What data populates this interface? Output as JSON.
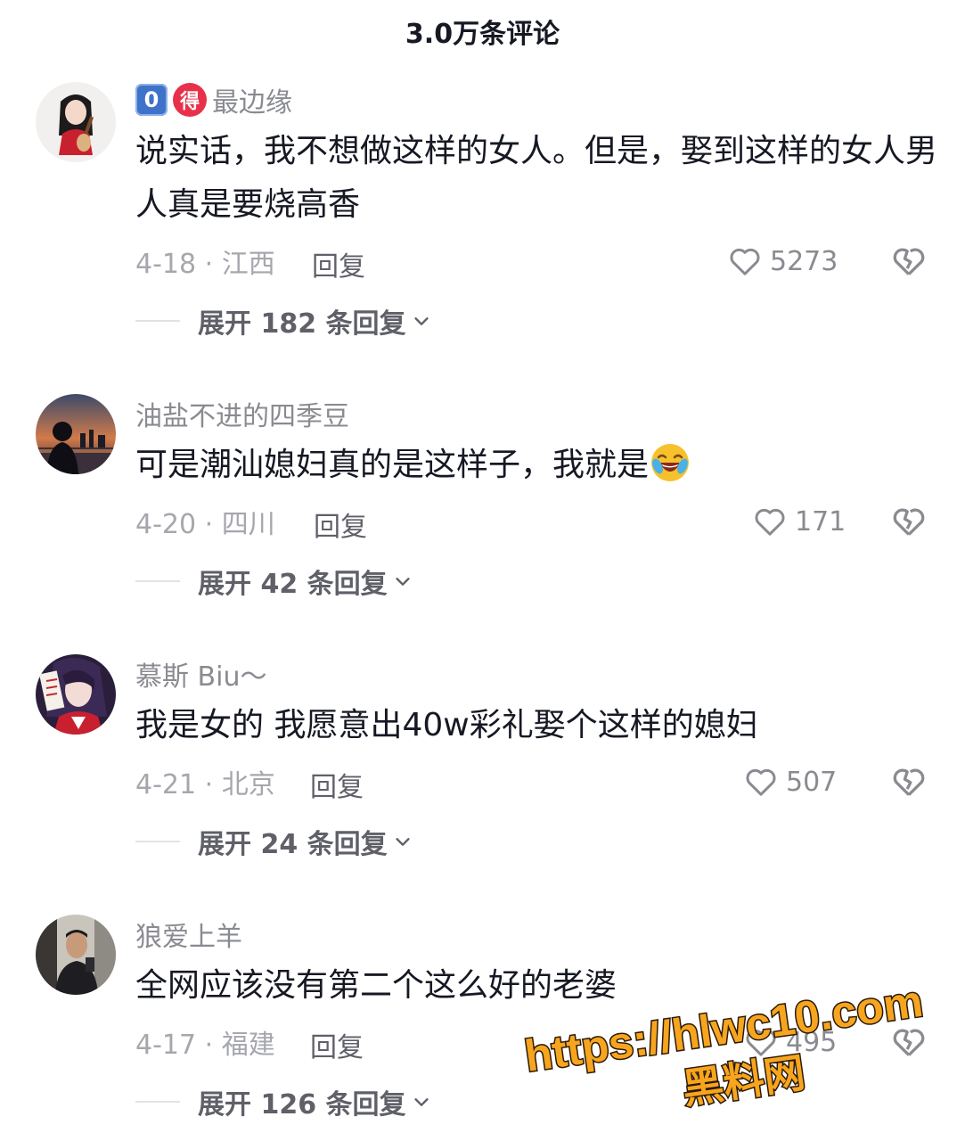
{
  "header": {
    "title": "3.0万条评论"
  },
  "comments": [
    {
      "badge_level": "0",
      "badge_de": "得",
      "username": "最边缘",
      "text": "说实话，我不想做这样的女人。但是，娶到这样的女人男人真是要烧高香",
      "date_location": "4-18 · 江西",
      "reply_label": "回复",
      "likes": "5273",
      "expand_label": "展开 182 条回复"
    },
    {
      "username": "油盐不进的四季豆",
      "text": "可是潮汕媳妇真的是这样子，我就是",
      "date_location": "4-20 · 四川",
      "reply_label": "回复",
      "likes": "171",
      "expand_label": "展开 42 条回复"
    },
    {
      "username": "慕斯 Biu～",
      "text": "我是女的 我愿意出40w彩礼娶个这样的媳妇",
      "date_location": "4-21 · 北京",
      "reply_label": "回复",
      "likes": "507",
      "expand_label": "展开 24 条回复"
    },
    {
      "username": "狼爱上羊",
      "text": "全网应该没有第二个这么好的老婆",
      "date_location": "4-17 · 福建",
      "reply_label": "回复",
      "likes": "495",
      "expand_label": "展开 126 条回复"
    }
  ],
  "watermark": {
    "line1": "https://hlwc10.com",
    "line2": "黑料网"
  },
  "icons": {
    "like": "heart-outline-icon",
    "dislike": "broken-heart-icon",
    "expand": "chevron-down-icon",
    "emoji": "laughing-emoji-icon"
  }
}
